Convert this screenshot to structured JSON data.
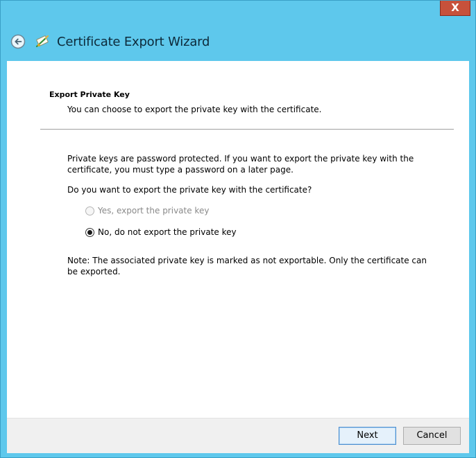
{
  "window": {
    "title": "Certificate Export Wizard",
    "close_label": "X"
  },
  "icons": {
    "back": "back-arrow-icon",
    "wizard": "certificate-icon"
  },
  "section": {
    "title": "Export Private Key",
    "subtitle": "You can choose to export the private key with the certificate."
  },
  "body": {
    "paragraph1": "Private keys are password protected. If you want to export the private key with the certificate, you must type a password on a later page.",
    "question": "Do you want to export the private key with the certificate?",
    "options": [
      {
        "label": "Yes, export the private key",
        "selected": false,
        "enabled": false
      },
      {
        "label": "No, do not export the private key",
        "selected": true,
        "enabled": true
      }
    ],
    "note": "Note: The associated private key is marked as not exportable. Only the certificate can be exported."
  },
  "footer": {
    "next_label": "Next",
    "cancel_label": "Cancel"
  },
  "colors": {
    "frame": "#5ec8ec",
    "close_button": "#c7513b",
    "content_bg": "#ffffff",
    "footer_bg": "#f0f0f0",
    "accent_border": "#4a8ed0"
  }
}
